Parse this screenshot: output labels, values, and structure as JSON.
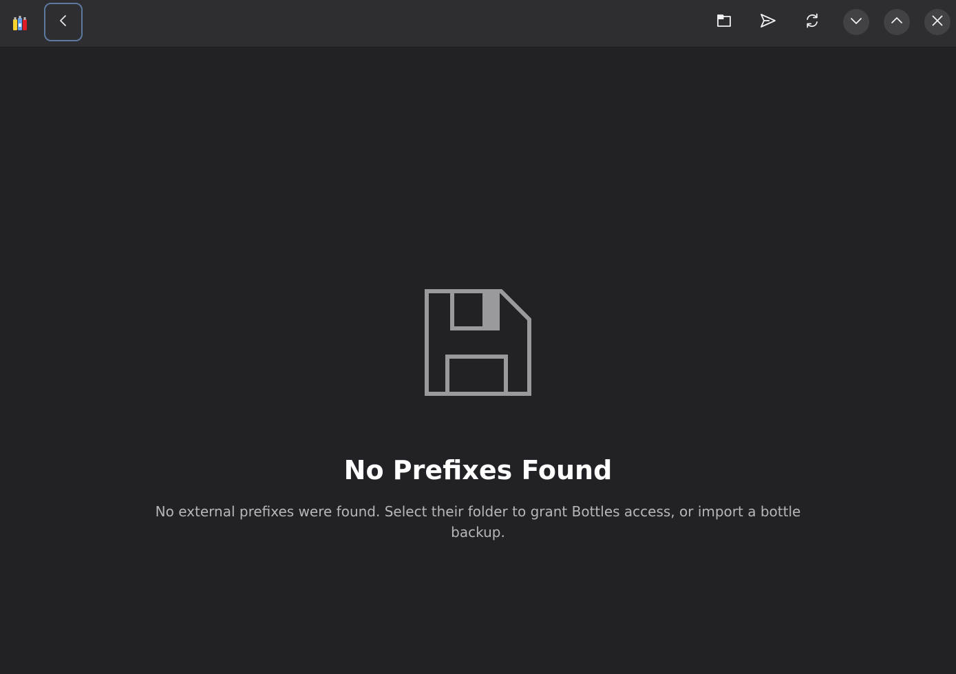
{
  "header": {
    "app_icon": "bottles-app-icon",
    "back_icon": "chevron-left-icon",
    "actions": [
      {
        "name": "open-folder-button",
        "icon": "folder-open-icon"
      },
      {
        "name": "send-button",
        "icon": "send-icon"
      },
      {
        "name": "refresh-button",
        "icon": "refresh-icon"
      }
    ],
    "window_controls": [
      {
        "name": "minimize-button",
        "icon": "chevron-down-icon"
      },
      {
        "name": "maximize-button",
        "icon": "chevron-up-icon"
      },
      {
        "name": "close-button",
        "icon": "close-icon"
      }
    ]
  },
  "status": {
    "icon": "floppy-disk-icon",
    "title": "No Prefixes Found",
    "description": "No external prefixes were found. Select their folder to grant Bottles access, or import a bottle backup."
  },
  "colors": {
    "background": "#222226",
    "headerbar": "#2e2e32",
    "focus_ring": "#5b7a9e",
    "icon_gray": "#9a9a9d"
  }
}
